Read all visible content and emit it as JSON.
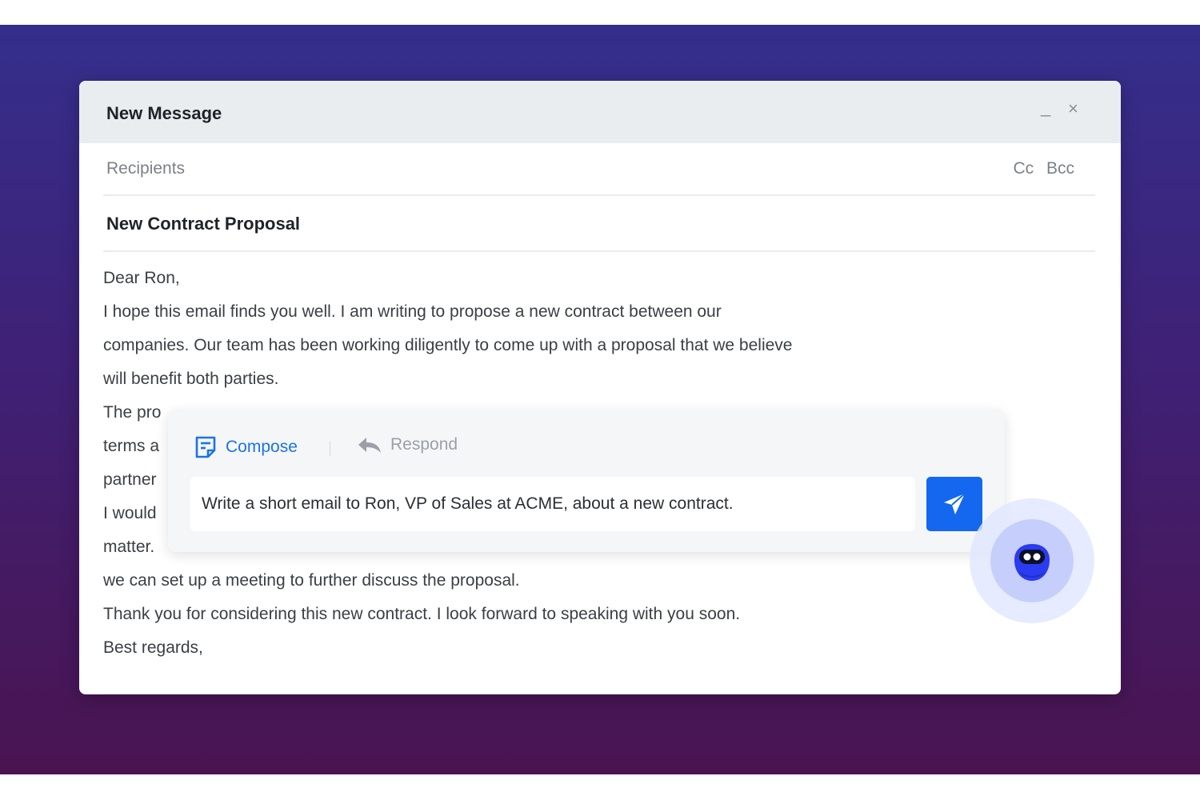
{
  "window": {
    "title": "New Message",
    "minimize_label": "_",
    "close_label": "×"
  },
  "recipients": {
    "label": "Recipients",
    "cc": "Cc",
    "bcc": "Bcc"
  },
  "subject": "New Contract Proposal",
  "body_lines": [
    "Dear Ron,",
    "I hope this email finds you well. I am writing to propose a new contract between our",
    "companies. Our team has been working diligently to come up with a proposal that we believe",
    "will benefit both parties.",
    "The pro",
    "terms a",
    "partner",
    "I would",
    "matter.",
    "we can set up a meeting to further discuss the proposal.",
    "Thank you for considering this new contract. I look forward to speaking with you soon.",
    "Best regards,"
  ],
  "ai_panel": {
    "tabs": [
      {
        "label": "Compose",
        "icon": "compose-icon",
        "active": true
      },
      {
        "label": "Respond",
        "icon": "reply-icon",
        "active": false
      }
    ],
    "prompt": "Write a short email to Ron, VP of Sales at ACME, about a new contract.",
    "send_icon": "send-icon"
  },
  "assistant": {
    "icon": "assistant-bot-icon"
  },
  "colors": {
    "accent": "#1468f0",
    "compose_active": "#1a73e8",
    "background_top": "#342f8c",
    "background_bottom": "#4a1450"
  }
}
